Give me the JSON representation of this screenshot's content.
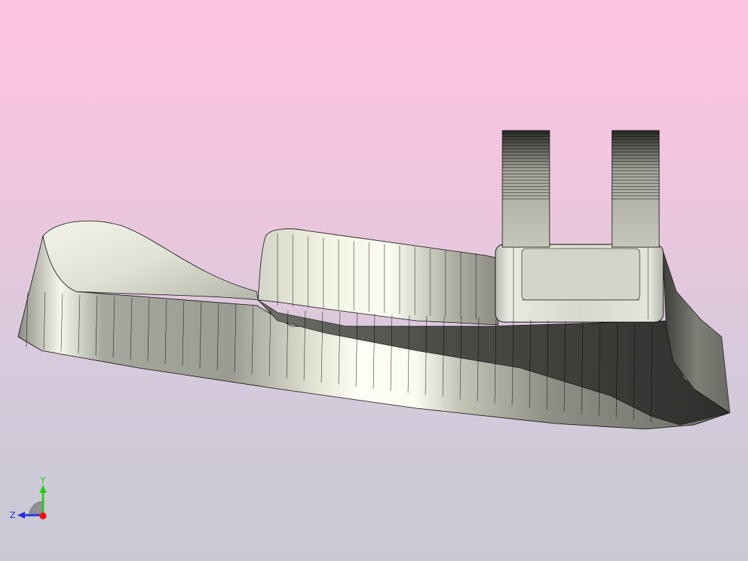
{
  "viewport": {
    "background_top_color": "#fdc4e0",
    "background_bottom_color": "#c9c9d4",
    "model": {
      "shaded_color": "#c8c9bd",
      "highlight_color": "#fdfdf2",
      "shadow_color": "#3a3b37",
      "edge_color": "#000000"
    },
    "triad": {
      "y_label": "Y",
      "z_label": "Z",
      "y_color": "#22cc22",
      "z_color": "#2233dd",
      "x_color": "#ee1111"
    }
  }
}
